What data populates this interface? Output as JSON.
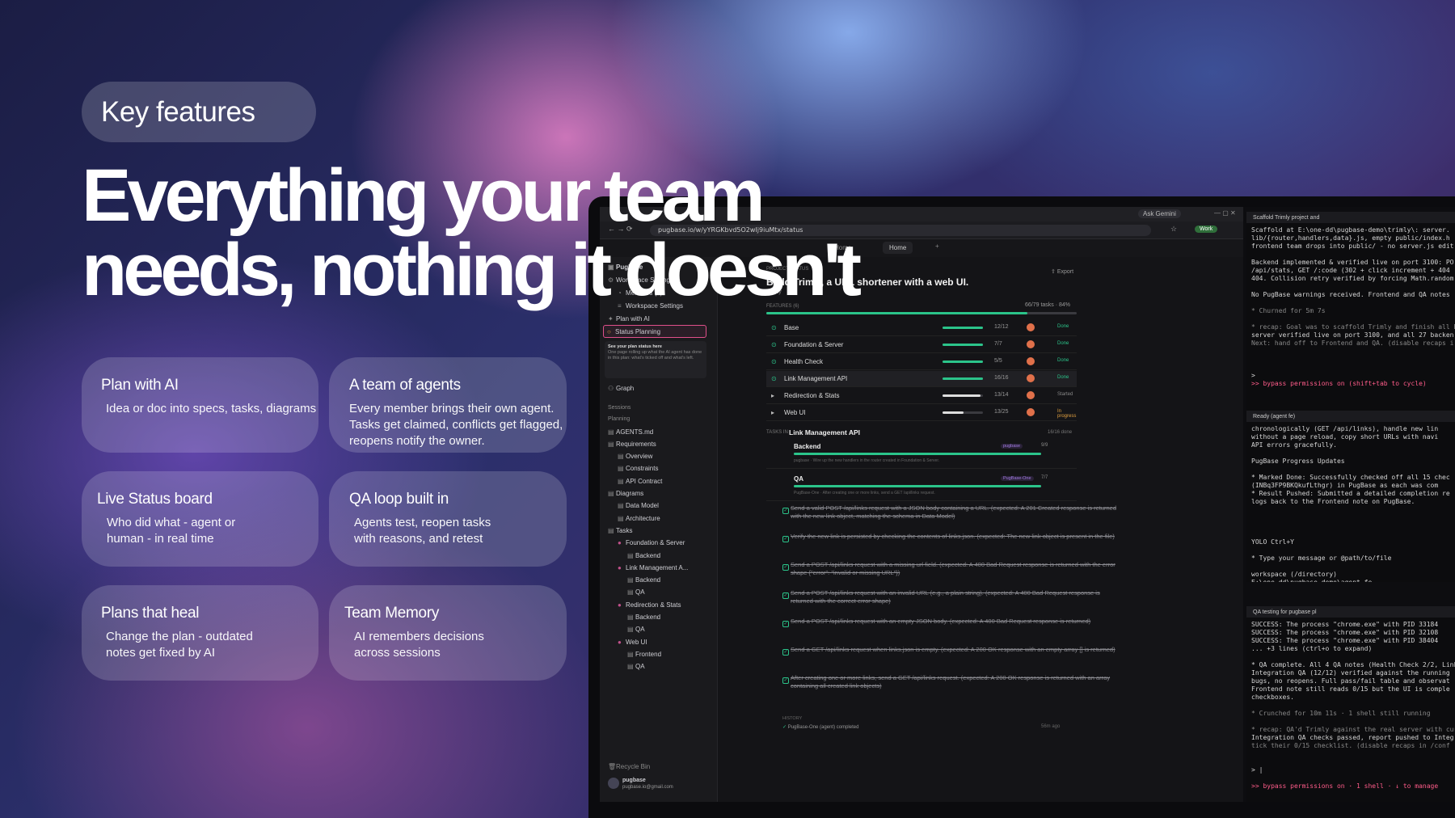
{
  "badge": "Key features",
  "headline": {
    "line1": "Everything your team",
    "line2": "needs, nothing it doesn't"
  },
  "features": [
    {
      "title": "Plan with AI",
      "desc": "Idea or doc into specs, tasks, diagrams"
    },
    {
      "title": "A team of agents",
      "desc": "Every member brings their own agent. Tasks get claimed, conflicts get flagged, reopens notify the owner."
    },
    {
      "title": "Live Status board",
      "desc": "Who did what - agent or human - in real time"
    },
    {
      "title": "QA loop built in",
      "desc": "Agents test, reopen tasks with reasons, and retest"
    },
    {
      "title": "Plans that heal",
      "desc": "Change the plan - outdated notes get fixed by AI"
    },
    {
      "title": "Team Memory",
      "desc": "AI remembers decisions across sessions"
    }
  ],
  "browser": {
    "url": "pugbase.io/w/yYRGKbvd5O2wIj9iuMtx/status",
    "ask_gemini": "Ask Gemini",
    "profile": "Work",
    "tabs": [
      "Home",
      "Home"
    ],
    "sidebar": {
      "workspace": "Pugbase",
      "items": [
        "Workspace Setting",
        "Members (3)",
        "Workspace Settings",
        "Plan with AI",
        "Status Planning",
        "Graph"
      ],
      "tooltip_title": "See your plan status here",
      "tooltip_body": "One page rolling up what the AI agent has done in this plan: what's ticked off and what's left.",
      "sessions_label": "Sessions",
      "planning_label": "Planning",
      "tree": [
        "AGENTS.md",
        "Requirements",
        "Overview",
        "Constraints",
        "API Contract",
        "Diagrams",
        "Data Model",
        "Architecture",
        "Tasks",
        "Foundation & Server",
        "Backend",
        "Link Management A...",
        "Backend",
        "QA",
        "Redirection & Stats",
        "Backend",
        "QA",
        "Web UI",
        "Frontend",
        "QA"
      ],
      "recycle": "Recycle Bin",
      "user_name": "pugbase",
      "user_email": "pugbase.io@gmail.com"
    },
    "status": {
      "section": "PROJECT STATUS",
      "export": "Export",
      "title": "Build Trimly, a URL shortener with a web UI.",
      "subtitle": "Trimly",
      "features_label": "FEATURES (6)",
      "progress_text": "66/79 tasks · 84%",
      "progress": 0.84,
      "features": [
        {
          "name": "Base",
          "count": "12/12",
          "state": "Done",
          "pct": 1.0
        },
        {
          "name": "Foundation & Server",
          "count": "7/7",
          "state": "Done",
          "pct": 1.0
        },
        {
          "name": "Health Check",
          "count": "5/5",
          "state": "Done",
          "pct": 1.0
        },
        {
          "name": "Link Management API",
          "count": "16/16",
          "state": "Done",
          "pct": 1.0
        },
        {
          "name": "Redirection & Stats",
          "count": "13/14",
          "state": "Started",
          "pct": 0.93
        },
        {
          "name": "Web UI",
          "count": "13/25",
          "state": "In progress",
          "pct": 0.52
        }
      ],
      "tasks_label": "TASKS IN",
      "tasks_feature": "Link Management API",
      "tasks_done": "16/16 done",
      "groups": [
        {
          "name": "Backend",
          "tag": "pugbase",
          "count": "9/9",
          "note": "pugbase · Wire up the new handlers in the router created in Foundation & Server."
        },
        {
          "name": "QA",
          "tag": "PugBase-One",
          "count": "7/7",
          "note": "PugBase-One · After creating one or more links, send a GET /api/links request."
        }
      ],
      "qa_tasks": [
        "Send a valid POST /api/links request with a JSON body containing a URL. (expected: A 201 Created response is returned with the new link object, matching the schema in Data Model)",
        "Verify the new link is persisted by checking the contents of links.json. (expected: The new link object is present in the file)",
        "Send a POST /api/links request with a missing url field. (expected: A 400 Bad Request response is returned with the error shape {\"error\": \"invalid or missing URL\"})",
        "Send a POST /api/links request with an invalid URL (e.g., a plain string). (expected: A 400 Bad Request response is returned with the correct error shape)",
        "Send a POST /api/links request with an empty JSON body. (expected: A 400 Bad Request response is returned)",
        "Send a GET /api/links request when links.json is empty. (expected: A 200 OK response with an empty array [] is returned)",
        "After creating one or more links, send a GET /api/links request. (expected: A 200 OK response is returned with an array containing all created link objects)"
      ],
      "history_label": "HISTORY",
      "history_item": "PugBase-One (agent) completed",
      "history_time": "56m ago"
    }
  },
  "terminals": [
    {
      "title": "Scaffold Trimly project and",
      "lines": [
        "Scaffold at E:\\one-dd\\pugbase-demo\\trimly\\: server.",
        "lib/{router,handlers,data}.js, empty public/index.h",
        "frontend team drops into public/ - no server.js edit",
        "",
        "Backend implemented & verified live on port 3100: PO",
        "/api/stats, GET /:code (302 + click increment + 404",
        "404. Collision retry verified by forcing Math.random",
        "",
        "No PugBase warnings received. Frontend and QA notes",
        "",
        "* Churned for 5m 7s",
        "",
        "* recap: Goal was to scaffold Trimly and finish all Ba",
        "  server verified live on port 3100, and all 27 backen",
        "  Next: hand off to Frontend and QA. (disable recaps i",
        "",
        "",
        "",
        ">",
        "  >> bypass permissions on (shift+tab to cycle)"
      ]
    },
    {
      "title": "Ready (agent fe)",
      "lines": [
        "  chronologically (GET /api/links), handle new lin",
        "  without a page reload, copy short URLs with navi",
        "  API errors gracefully.",
        "",
        "  PugBase Progress Updates",
        "",
        "  * Marked Done: Successfully checked off all 15 chec",
        "    (INBq3FP9BKQkufLthgr) in PugBase as each was com",
        "  * Result Pushed: Submitted a detailed completion re",
        "    logs back to the Frontend note on PugBase.",
        "",
        "",
        "",
        "",
        "YOLO Ctrl+Y",
        "",
        "  * Type your message or @path/to/file",
        "",
        "workspace (/directory)",
        "E:\\one-dd\\pugbase-demo\\agent-fe"
      ]
    },
    {
      "title": "QA testing for pugbase pl",
      "lines": [
        "  SUCCESS: The process \"chrome.exe\" with PID 33184",
        "  SUCCESS: The process \"chrome.exe\" with PID 32108",
        "  SUCCESS: The process \"chrome.exe\" with PID 38404",
        "   ... +3 lines (ctrl+o to expand)",
        "",
        "* QA complete. All 4 QA notes (Health Check 2/2, Link",
        "  Integration QA (12/12) verified against the running",
        "  bugs, no reopens. Full pass/fail table and observat",
        "  Frontend note still reads 0/15 but the UI is comple",
        "  checkboxes.",
        "",
        "* Crunched for 10m 11s · 1 shell still running",
        "",
        "* recap: QA'd Trimly against the real server with cur",
        "  Integration QA checks passed, report pushed to Integ",
        "  tick their 0/15 checklist. (disable recaps in /conf",
        "",
        "",
        "> |",
        "",
        "  >> bypass permissions on · 1 shell · ↓ to manage"
      ]
    }
  ]
}
